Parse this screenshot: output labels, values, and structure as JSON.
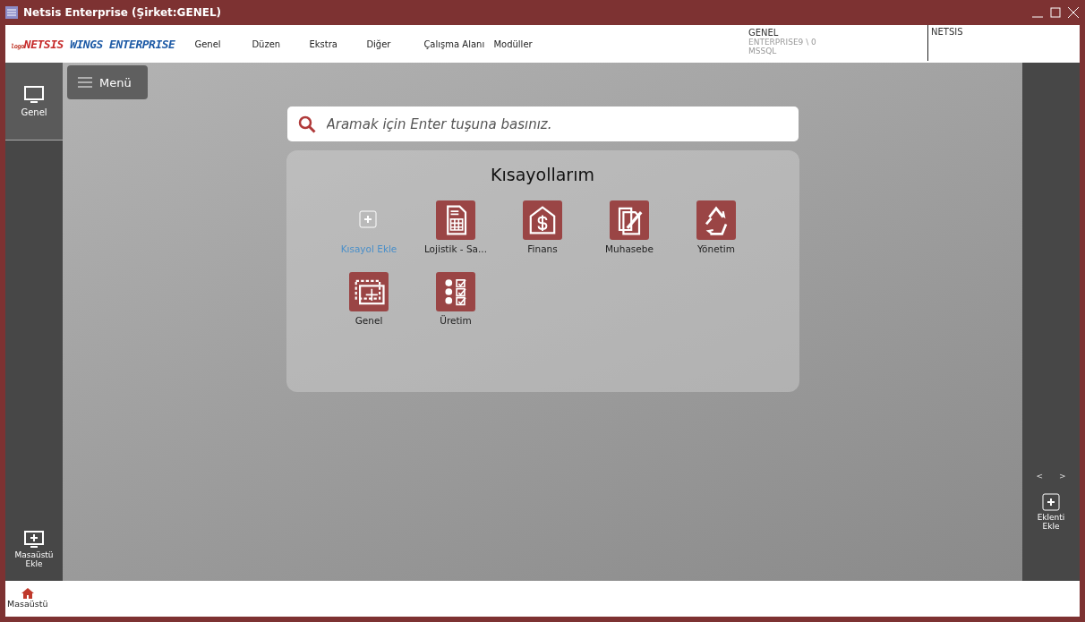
{
  "window": {
    "title": "Netsis Enterprise (Şirket:GENEL)"
  },
  "brand": {
    "prefix": "logo",
    "name": "NETSIS",
    "suffix": "WINGS ENTERPRISE"
  },
  "menu": [
    "Genel",
    "Düzen",
    "Ekstra",
    "Diğer",
    "Çalışma Alanı",
    "Modüller"
  ],
  "connection": {
    "company": "GENEL",
    "server": "ENTERPRISE9 \\ 0",
    "database": "MSSQL",
    "user": "NETSIS"
  },
  "sidebar": {
    "items": [
      {
        "label": "Genel",
        "selected": true
      }
    ],
    "add_label": "Masaüstü Ekle"
  },
  "menu_button": "Menü",
  "search": {
    "placeholder": "Aramak için Enter tuşuna basınız."
  },
  "shortcuts": {
    "title": "Kısayollarım",
    "items": [
      {
        "kind": "add",
        "label": "Kısayol Ekle"
      },
      {
        "kind": "module",
        "label": "Lojistik - Sa..."
      },
      {
        "kind": "module",
        "label": "Finans"
      },
      {
        "kind": "module",
        "label": "Muhasebe"
      },
      {
        "kind": "module",
        "label": "Yönetim"
      },
      {
        "kind": "module",
        "label": "Genel"
      },
      {
        "kind": "module",
        "label": "Üretim"
      }
    ]
  },
  "right_panel": {
    "prev": "<",
    "next": ">",
    "add_label": "Eklenti Ekle"
  },
  "taskbar": [
    {
      "label": "Masaüstü",
      "selected": true
    }
  ]
}
